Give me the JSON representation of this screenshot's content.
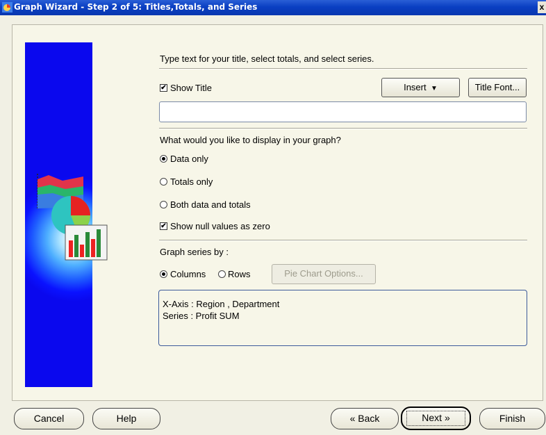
{
  "window": {
    "title": "Graph Wizard - Step 2 of 5: Titles,Totals, and Series",
    "close_glyph": "x"
  },
  "instructions": "Type text for your title, select totals, and select series.",
  "title_section": {
    "show_title": {
      "label": "Show Title",
      "checked": true
    },
    "insert_button": "Insert",
    "title_font_button": "Title Font...",
    "title_input_value": ""
  },
  "display_section": {
    "question": "What would you like to display in your graph?",
    "options": [
      {
        "label": "Data only",
        "selected": true
      },
      {
        "label": "Totals only",
        "selected": false
      },
      {
        "label": "Both data and totals",
        "selected": false
      }
    ],
    "show_null": {
      "label": "Show null values as zero",
      "checked": true
    }
  },
  "series_section": {
    "label": "Graph series by :",
    "columns": {
      "label": "Columns",
      "selected": true
    },
    "rows": {
      "label": "Rows",
      "selected": false
    },
    "pie_options_button": "Pie Chart Options...",
    "info_lines": [
      "X-Axis : Region , Department",
      "Series : Profit SUM"
    ]
  },
  "footer": {
    "cancel": "Cancel",
    "help": "Help",
    "back": "Back",
    "next": "Next",
    "finish": "Finish"
  },
  "colors": {
    "titlebar": "#0a3fc2",
    "panel_blue": "#0a12ff",
    "dialog_bg": "#f1f0e4"
  }
}
